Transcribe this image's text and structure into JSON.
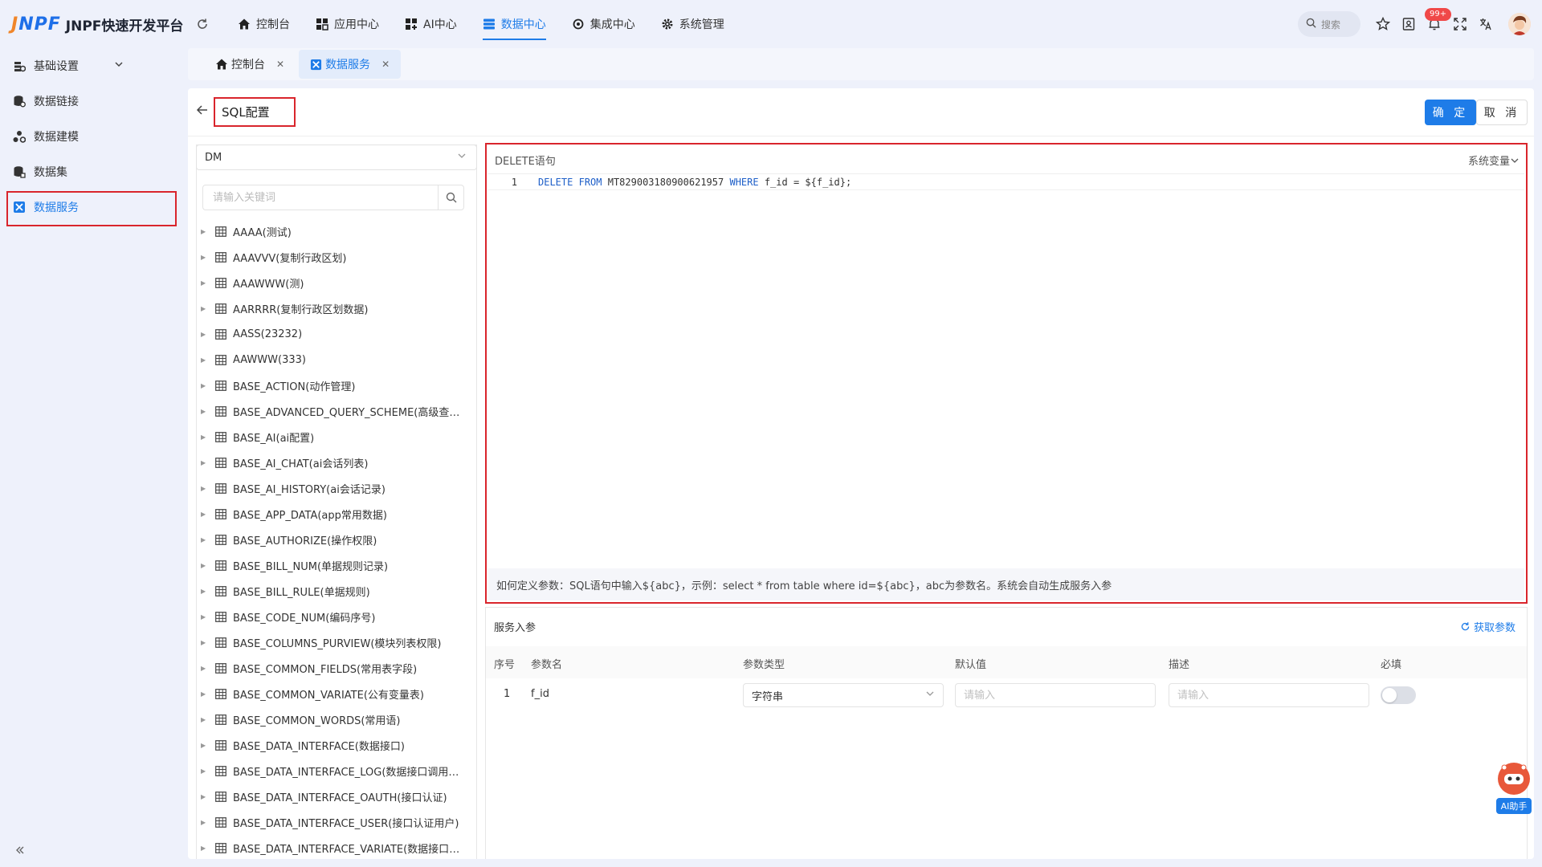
{
  "header": {
    "logo_mark": "JNPF",
    "app_title": "JNPF快速开发平台",
    "nav": [
      {
        "label": "控制台",
        "icon": "home-icon"
      },
      {
        "label": "应用中心",
        "icon": "apps-icon"
      },
      {
        "label": "AI中心",
        "icon": "ai-icon"
      },
      {
        "label": "数据中心",
        "icon": "database-icon",
        "active": true
      },
      {
        "label": "集成中心",
        "icon": "integration-icon"
      },
      {
        "label": "系统管理",
        "icon": "gear-icon"
      }
    ],
    "search_placeholder": "搜索",
    "notification_badge": "99+"
  },
  "sidebar": {
    "items": [
      {
        "label": "基础设置",
        "icon": "settings-icon"
      },
      {
        "label": "数据链接",
        "icon": "database-link-icon"
      },
      {
        "label": "数据建模",
        "icon": "model-icon"
      },
      {
        "label": "数据集",
        "icon": "dataset-icon"
      },
      {
        "label": "数据服务",
        "icon": "service-icon",
        "active": true
      }
    ]
  },
  "tabs": [
    {
      "label": "控制台",
      "icon": "home-icon"
    },
    {
      "label": "数据服务",
      "icon": "service-icon",
      "active": true
    }
  ],
  "page": {
    "title": "SQL配置",
    "ok_label": "确 定",
    "cancel_label": "取 消"
  },
  "left_panel": {
    "db_value": "DM",
    "keyword_placeholder": "请输入关键词",
    "tables": [
      "AAAA(测试)",
      "AAAVVV(复制行政区划)",
      "AAAWWW(测)",
      "AARRRR(复制行政区划数据)",
      "AASS(23232)",
      "AAWWW(333)",
      "BASE_ACTION(动作管理)",
      "BASE_ADVANCED_QUERY_SCHEME(高级查询方案)",
      "BASE_AI(ai配置)",
      "BASE_AI_CHAT(ai会话列表)",
      "BASE_AI_HISTORY(ai会话记录)",
      "BASE_APP_DATA(app常用数据)",
      "BASE_AUTHORIZE(操作权限)",
      "BASE_BILL_NUM(单据规则记录)",
      "BASE_BILL_RULE(单据规则)",
      "BASE_CODE_NUM(编码序号)",
      "BASE_COLUMNS_PURVIEW(模块列表权限)",
      "BASE_COMMON_FIELDS(常用表字段)",
      "BASE_COMMON_VARIATE(公有变量表)",
      "BASE_COMMON_WORDS(常用语)",
      "BASE_DATA_INTERFACE(数据接口)",
      "BASE_DATA_INTERFACE_LOG(数据接口调用日志)",
      "BASE_DATA_INTERFACE_OAUTH(接口认证)",
      "BASE_DATA_INTERFACE_USER(接口认证用户)",
      "BASE_DATA_INTERFACE_VARIATE(数据接口变量)"
    ]
  },
  "editor": {
    "label": "DELETE语句",
    "sysvar_label": "系统变量",
    "line_number": "1",
    "code": {
      "kw1": "DELETE",
      "kw2": "FROM",
      "table": "MT829003180900621957",
      "kw3": "WHERE",
      "rest": "f_id = ${f_id};"
    },
    "hint": "如何定义参数：SQL语句中输入${abc}，示例：select * from table where id=${abc}，abc为参数名。系统会自动生成服务入参"
  },
  "params": {
    "title": "服务入参",
    "fetch_label": "获取参数",
    "headers": [
      "序号",
      "参数名",
      "参数类型",
      "默认值",
      "描述",
      "必填"
    ],
    "rows": [
      {
        "index": "1",
        "name": "f_id",
        "type": "字符串",
        "default_placeholder": "请输入",
        "desc_placeholder": "请输入",
        "required": false
      }
    ]
  },
  "ai_assistant_label": "AI助手",
  "colors": {
    "accent": "#1e7ce8",
    "highlight_border": "#d9252c",
    "logo_orange": "#f0862a"
  }
}
